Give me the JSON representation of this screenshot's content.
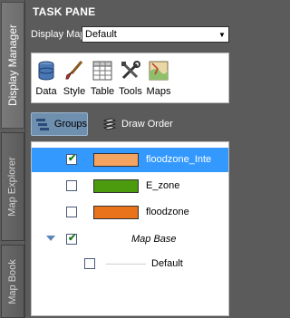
{
  "side_tabs": [
    {
      "label": "Display Manager",
      "active": true
    },
    {
      "label": "Map Explorer",
      "active": false
    },
    {
      "label": "Map Book",
      "active": false
    }
  ],
  "pane": {
    "title": "TASK PANE",
    "display_map_label": "Display Map:",
    "display_map_value": "Default"
  },
  "toolbar": {
    "items": [
      {
        "label": "Data",
        "icon": "database-icon"
      },
      {
        "label": "Style",
        "icon": "paintbrush-icon"
      },
      {
        "label": "Table",
        "icon": "table-icon"
      },
      {
        "label": "Tools",
        "icon": "tools-icon"
      },
      {
        "label": "Maps",
        "icon": "maps-icon"
      }
    ]
  },
  "view_buttons": {
    "groups_label": "Groups",
    "draw_order_label": "Draw Order"
  },
  "layers": [
    {
      "name": "floodzone_Inte",
      "checked": true,
      "swatch": "#f4a460",
      "selected": true
    },
    {
      "name": "E_zone",
      "checked": false,
      "swatch": "#4c9a0e",
      "selected": false
    },
    {
      "name": "floodzone",
      "checked": false,
      "swatch": "#e8731a",
      "selected": false
    }
  ],
  "group": {
    "name": "Map Base",
    "checked": true,
    "expanded": true,
    "children": [
      {
        "name": "Default",
        "checked": false
      }
    ]
  },
  "colors": {
    "selection": "#3399ff",
    "pane_bg": "#5b5b5b"
  }
}
